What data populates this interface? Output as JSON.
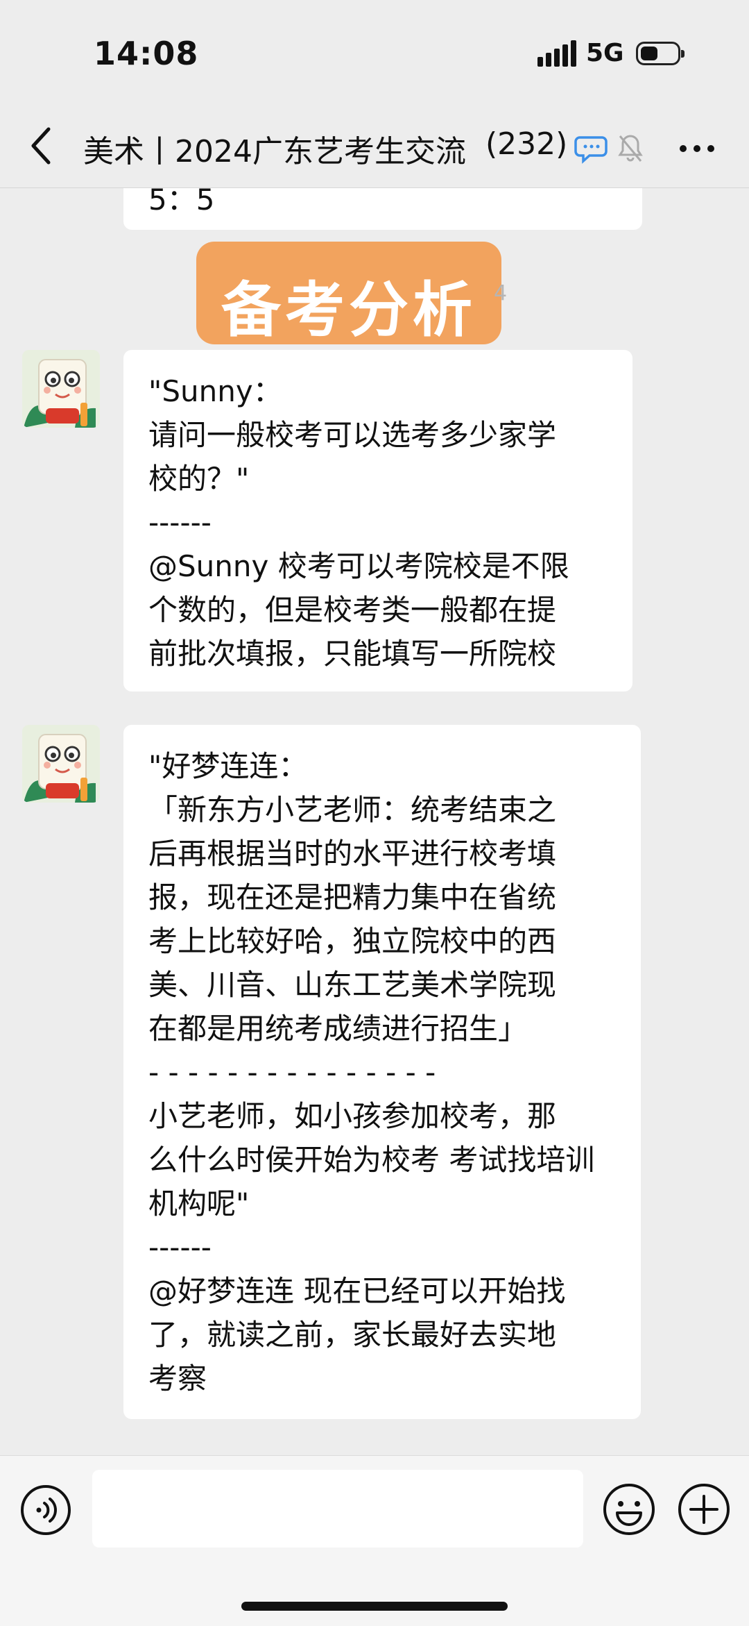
{
  "status": {
    "time": "14:08",
    "network": "5G"
  },
  "nav": {
    "title": "美术丨2024广东艺考生交流",
    "member_count": "(232)"
  },
  "chat": {
    "partial_bubble": "5：5",
    "banner_text": "备考分析",
    "ghost_text": "4",
    "messages": [
      {
        "avatar": "cartoon-character-avatar",
        "lines": [
          "\"Sunny：",
          "请问一般校考可以选考多少家学",
          "校的？\"",
          "------",
          "@Sunny 校考可以考院校是不限",
          "个数的，但是校考类一般都在提",
          "前批次填报，只能填写一所院校"
        ]
      },
      {
        "avatar": "cartoon-character-avatar",
        "lines": [
          "\"好梦连连：",
          "「新东方小艺老师：统考结束之",
          "后再根据当时的水平进行校考填",
          "报，现在还是把精力集中在省统",
          "考上比较好哈，独立院校中的西",
          "美、川音、山东工艺美术学院现",
          "在都是用统考成绩进行招生」",
          "- - - - - - - - - - - - - - -",
          "小艺老师，如小孩参加校考，那",
          "么什么时侯开始为校考 考试找培训",
          "机构呢\"",
          "------",
          "@好梦连连 现在已经可以开始找",
          "了，就读之前，家长最好去实地",
          "考察"
        ]
      }
    ]
  },
  "composer": {
    "input_value": ""
  },
  "icons": {
    "back": "chevron-left-icon",
    "chat": "chat-bubble-icon",
    "mute": "mute-bell-icon",
    "more": "more-dots-icon",
    "voice": "voice-icon",
    "emoji": "emoji-icon",
    "plus": "plus-icon"
  },
  "colors": {
    "banner": "#f2a35e",
    "background": "#ededed",
    "bubble": "#ffffff"
  }
}
